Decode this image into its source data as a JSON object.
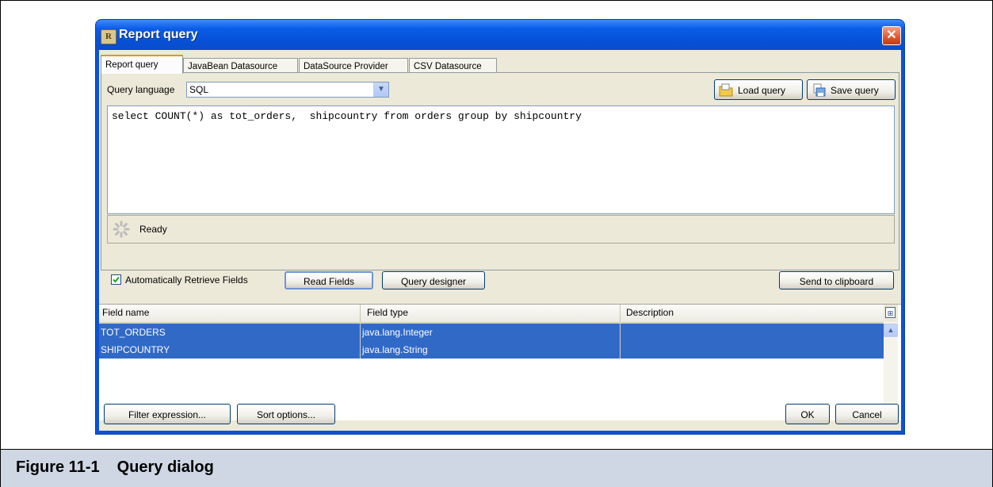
{
  "window": {
    "title": "Report query"
  },
  "tabs": [
    "Report query",
    "JavaBean Datasource",
    "DataSource Provider",
    "CSV Datasource"
  ],
  "query": {
    "language_label": "Query language",
    "language_value": "SQL",
    "load_label": "Load query",
    "save_label": "Save query",
    "text": "select COUNT(*) as tot_orders,  shipcountry from orders group by shipcountry"
  },
  "status": {
    "text": "Ready"
  },
  "options": {
    "auto_retrieve_label": "Automatically Retrieve Fields",
    "auto_retrieve_checked": true,
    "read_fields_label": "Read Fields",
    "query_designer_label": "Query designer",
    "send_clipboard_label": "Send to clipboard"
  },
  "fields_table": {
    "columns": [
      "Field name",
      "Field type",
      "Description"
    ],
    "rows": [
      {
        "name": "TOT_ORDERS",
        "type": "java.lang.Integer",
        "description": ""
      },
      {
        "name": "SHIPCOUNTRY",
        "type": "java.lang.String",
        "description": ""
      }
    ]
  },
  "footer": {
    "filter_label": "Filter expression...",
    "sort_label": "Sort options...",
    "ok_label": "OK",
    "cancel_label": "Cancel"
  },
  "figure": {
    "number": "Figure 11-1",
    "title": "Query dialog"
  },
  "icons": [
    "app-icon",
    "close-icon",
    "folder-icon",
    "save-icon",
    "dropdown-arrow-icon",
    "spinner-icon",
    "checkmark-icon",
    "column-chooser-icon",
    "scroll-up-icon",
    "scroll-down-icon"
  ]
}
